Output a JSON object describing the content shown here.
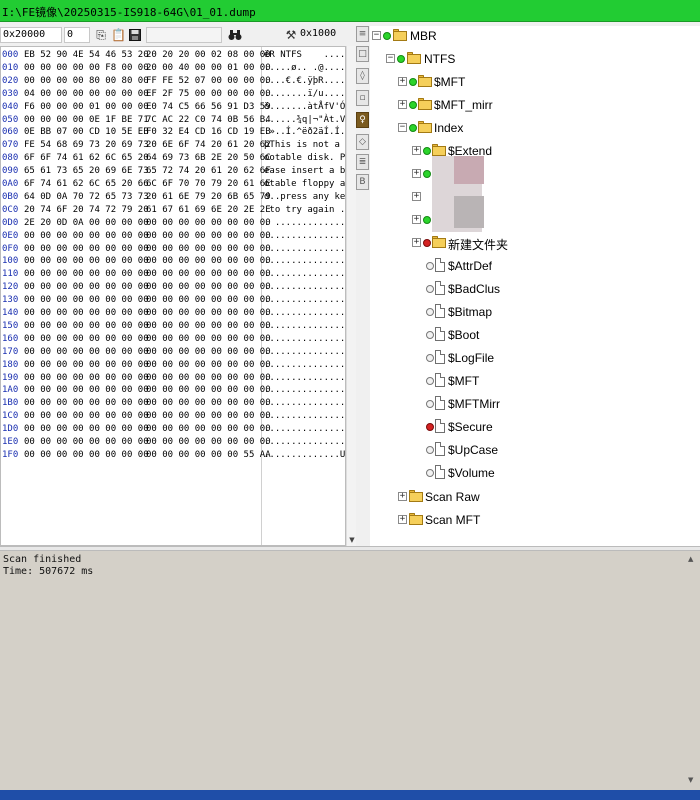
{
  "window": {
    "title": "I:\\FE镜像\\20250315-IS918-64G\\01_01.dump",
    "title_bar_color": "#22cc33"
  },
  "toolbar": {
    "address_value": "0x20000",
    "offset_value": "0",
    "search_value": "",
    "jump_value": "0x1000",
    "icons": [
      "copy-icon",
      "paste-icon",
      "save-icon",
      "binoculars-icon",
      "tools-icon"
    ]
  },
  "hex": {
    "rows": [
      {
        "off": "000",
        "h1": "EB 52 90 4E 54 46 53 20",
        "h2": "20 20 20 00 02 08 00 00",
        "asc": "ëR NTFS    ....."
      },
      {
        "off": "010",
        "h1": "00 00 00 00 00 F8 00 00",
        "h2": "20 00 40 00 00 01 00 00",
        "asc": ".....ø.. .@....."
      },
      {
        "off": "020",
        "h1": "00 00 00 00 80 00 80 00",
        "h2": "FF FE 52 07 00 00 00 00",
        "asc": "....€.€.ÿþR....."
      },
      {
        "off": "030",
        "h1": "04 00 00 00 00 00 00 00",
        "h2": "EF 2F 75 00 00 00 00 00",
        "asc": "........ï/u....."
      },
      {
        "off": "040",
        "h1": "F6 00 00 00 01 00 00 00",
        "h2": "E0 74 C5 66 56 91 D3 59",
        "asc": "ö.......àtÅfV'ÓY"
      },
      {
        "off": "050",
        "h1": "00 00 00 00 0E 1F BE 71",
        "h2": "7C AC 22 C0 74 0B 56 B4",
        "asc": "......¾q|¬\"Àt.V´"
      },
      {
        "off": "060",
        "h1": "0E BB 07 00 CD 10 5E EB",
        "h2": "F0 32 E4 CD 16 CD 19 EB",
        "asc": ".»..Í.^ëð2äÍ.Í.ë"
      },
      {
        "off": "070",
        "h1": "FE 54 68 69 73 20 69 73",
        "h2": "20 6E 6F 74 20 61 20 62",
        "asc": "þThis is not a b"
      },
      {
        "off": "080",
        "h1": "6F 6F 74 61 62 6C 65 20",
        "h2": "64 69 73 6B 2E 20 50 6C",
        "asc": "ootable disk. Pl"
      },
      {
        "off": "090",
        "h1": "65 61 73 65 20 69 6E 73",
        "h2": "65 72 74 20 61 20 62 6F",
        "asc": "ease insert a bo"
      },
      {
        "off": "0A0",
        "h1": "6F 74 61 62 6C 65 20 66",
        "h2": "6C 6F 70 70 79 20 61 6E",
        "asc": "otable floppy an"
      },
      {
        "off": "0B0",
        "h1": "64 0D 0A 70 72 65 73 73",
        "h2": "20 61 6E 79 20 6B 65 79",
        "asc": "d..press any key"
      },
      {
        "off": "0C0",
        "h1": "20 74 6F 20 74 72 79 20",
        "h2": "61 67 61 69 6E 20 2E 2E",
        "asc": " to try again .."
      },
      {
        "off": "0D0",
        "h1": "2E 20 0D 0A 00 00 00 00",
        "h2": "00 00 00 00 00 00 00 00",
        "asc": ". .............."
      },
      {
        "off": "0E0",
        "h1": "00 00 00 00 00 00 00 00",
        "h2": "00 00 00 00 00 00 00 00",
        "asc": "................"
      },
      {
        "off": "0F0",
        "h1": "00 00 00 00 00 00 00 00",
        "h2": "00 00 00 00 00 00 00 00",
        "asc": "................"
      },
      {
        "off": "100",
        "h1": "00 00 00 00 00 00 00 00",
        "h2": "00 00 00 00 00 00 00 00",
        "asc": "................"
      },
      {
        "off": "110",
        "h1": "00 00 00 00 00 00 00 00",
        "h2": "00 00 00 00 00 00 00 00",
        "asc": "................"
      },
      {
        "off": "120",
        "h1": "00 00 00 00 00 00 00 00",
        "h2": "00 00 00 00 00 00 00 00",
        "asc": "................"
      },
      {
        "off": "130",
        "h1": "00 00 00 00 00 00 00 00",
        "h2": "00 00 00 00 00 00 00 00",
        "asc": "................"
      },
      {
        "off": "140",
        "h1": "00 00 00 00 00 00 00 00",
        "h2": "00 00 00 00 00 00 00 00",
        "asc": "................"
      },
      {
        "off": "150",
        "h1": "00 00 00 00 00 00 00 00",
        "h2": "00 00 00 00 00 00 00 00",
        "asc": "................"
      },
      {
        "off": "160",
        "h1": "00 00 00 00 00 00 00 00",
        "h2": "00 00 00 00 00 00 00 00",
        "asc": "................"
      },
      {
        "off": "170",
        "h1": "00 00 00 00 00 00 00 00",
        "h2": "00 00 00 00 00 00 00 00",
        "asc": "................"
      },
      {
        "off": "180",
        "h1": "00 00 00 00 00 00 00 00",
        "h2": "00 00 00 00 00 00 00 00",
        "asc": "................"
      },
      {
        "off": "190",
        "h1": "00 00 00 00 00 00 00 00",
        "h2": "00 00 00 00 00 00 00 00",
        "asc": "................"
      },
      {
        "off": "1A0",
        "h1": "00 00 00 00 00 00 00 00",
        "h2": "00 00 00 00 00 00 00 00",
        "asc": "................"
      },
      {
        "off": "1B0",
        "h1": "00 00 00 00 00 00 00 00",
        "h2": "00 00 00 00 00 00 00 00",
        "asc": "................"
      },
      {
        "off": "1C0",
        "h1": "00 00 00 00 00 00 00 00",
        "h2": "00 00 00 00 00 00 00 00",
        "asc": "................"
      },
      {
        "off": "1D0",
        "h1": "00 00 00 00 00 00 00 00",
        "h2": "00 00 00 00 00 00 00 00",
        "asc": "................"
      },
      {
        "off": "1E0",
        "h1": "00 00 00 00 00 00 00 00",
        "h2": "00 00 00 00 00 00 00 00",
        "asc": "................"
      },
      {
        "off": "1F0",
        "h1": "00 00 00 00 00 00 00 00",
        "h2": "00 00 00 00 00 00 55 AA",
        "asc": "..............Uª"
      }
    ]
  },
  "side_tools": [
    "list-icon",
    "page-icon",
    "index-icon",
    "record-icon",
    "lightbulb-icon",
    "gear-icon",
    "document-icon",
    "bookmark-icon"
  ],
  "tree": {
    "mbr": {
      "label": "MBR",
      "expander": "−",
      "status": "green"
    },
    "ntfs": {
      "label": "NTFS",
      "expander": "−",
      "status": "green"
    },
    "mft": {
      "label": "$MFT",
      "expander": "+",
      "status": "green"
    },
    "mft_mirr_folder": {
      "label": "$MFT_mirr",
      "expander": "+",
      "status": "green"
    },
    "index": {
      "label": "Index",
      "expander": "−",
      "status": "green"
    },
    "extend": {
      "label": "$Extend",
      "expander": "+",
      "status": "green"
    },
    "hidden_1": {
      "expander": "+",
      "status": "green"
    },
    "hidden_2": {
      "expander": "+",
      "status": "green"
    },
    "hidden_3": {
      "expander": "+",
      "status": "green"
    },
    "new_folder": {
      "label": "新建文件夹",
      "expander": "+",
      "status": "red"
    },
    "attrdef": {
      "label": "$AttrDef",
      "status": "white"
    },
    "badclus": {
      "label": "$BadClus",
      "status": "white"
    },
    "bitmap": {
      "label": "$Bitmap",
      "status": "white"
    },
    "boot": {
      "label": "$Boot",
      "status": "white"
    },
    "logfile": {
      "label": "$LogFile",
      "status": "white"
    },
    "mft_file": {
      "label": "$MFT",
      "status": "white"
    },
    "mftmirr_file": {
      "label": "$MFTMirr",
      "status": "white"
    },
    "secure": {
      "label": "$Secure",
      "status": "red"
    },
    "upcase": {
      "label": "$UpCase",
      "status": "white"
    },
    "volume": {
      "label": "$Volume",
      "status": "white"
    },
    "scan_raw": {
      "label": "Scan Raw",
      "expander": "+"
    },
    "scan_mft": {
      "label": "Scan MFT",
      "expander": "+"
    }
  },
  "log": {
    "line1": "Scan finished",
    "line2": "Time: 507672 ms"
  },
  "colors": {
    "offset_blue": "#1a2fb0",
    "folder_yellow": "#f5cf5a",
    "status_green": "#2bd42b",
    "status_red": "#d42222"
  }
}
